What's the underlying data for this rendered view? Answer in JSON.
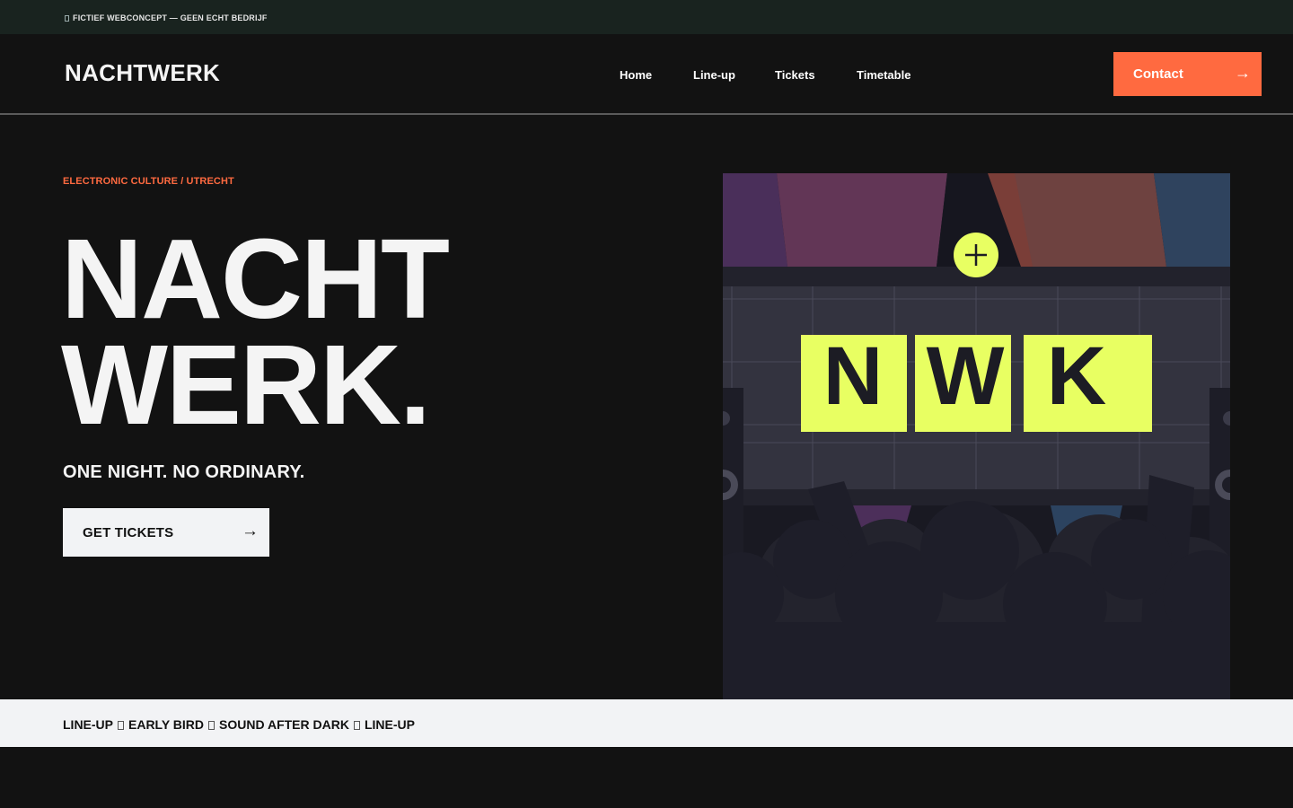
{
  "topbar": {
    "text": "FICTIEF WEBCONCEPT — GEEN ECHT BEDRIJF"
  },
  "nav": {
    "logo": "NACHTWERK",
    "links": [
      "Home",
      "Line-up",
      "Tickets",
      "Timetable"
    ],
    "contact_label": "Contact",
    "contact_arrow": "→"
  },
  "hero": {
    "eyebrow": "ELECTRONIC CULTURE / UTRECHT",
    "title_line1": "NACHT",
    "title_line2": "WERK.",
    "tagline": "ONE NIGHT. NO ORDINARY.",
    "cta_label": "GET TICKETS",
    "cta_arrow": "→",
    "screen_letters": [
      "N",
      "W",
      "K"
    ],
    "screen_plus": "+"
  },
  "ticker": {
    "items": [
      "LINE-UP",
      "EARLY BIRD",
      "SOUND AFTER DARK",
      "LINE-UP"
    ]
  },
  "colors": {
    "accent": "#ff6a40",
    "screen_yellow": "#e8ff62",
    "background": "#121212",
    "topbar": "#19231f",
    "light": "#f2f3f5"
  }
}
